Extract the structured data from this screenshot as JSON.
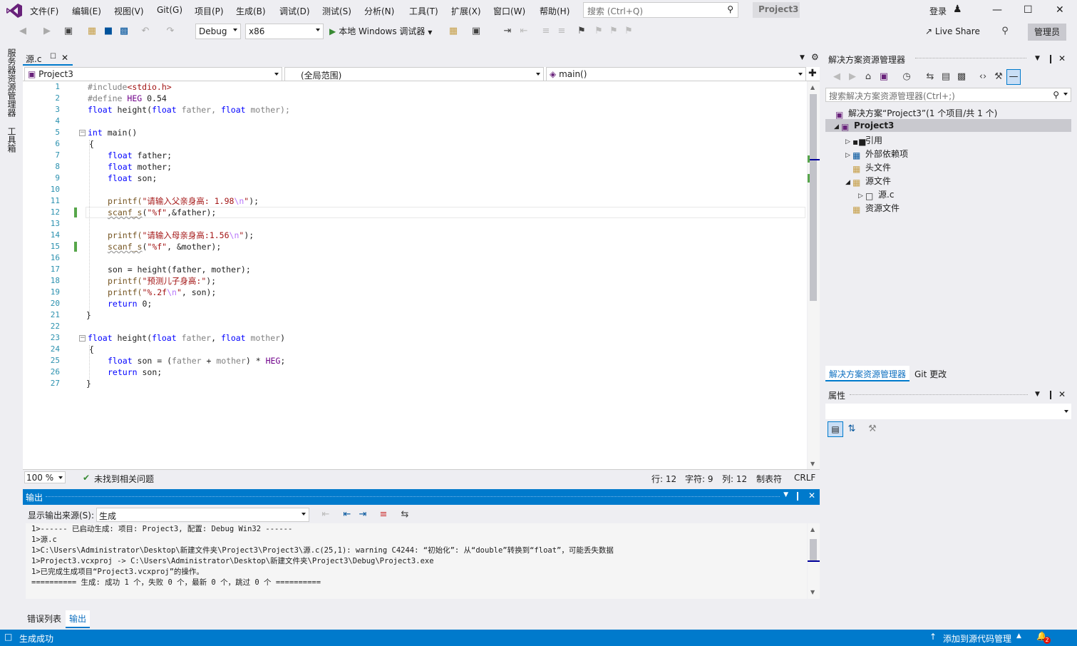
{
  "menubar": {
    "items": [
      "文件(F)",
      "编辑(E)",
      "视图(V)",
      "Git(G)",
      "项目(P)",
      "生成(B)",
      "调试(D)",
      "测试(S)",
      "分析(N)",
      "工具(T)",
      "扩展(X)",
      "窗口(W)",
      "帮助(H)"
    ],
    "search_placeholder": "搜索 (Ctrl+Q)",
    "project_title": "Project3",
    "login": "登录"
  },
  "toolbar": {
    "config": "Debug",
    "platform": "x86",
    "run_label": "本地 Windows 调试器",
    "live_share": "Live Share",
    "admin": "管理员"
  },
  "left_strip": {
    "server_explorer": "服务器资源管理器",
    "toolbox": "工具箱"
  },
  "editor": {
    "tab": "源.c",
    "nav_project": "Project3",
    "nav_scope": "(全局范围)",
    "nav_member": "main()",
    "line_numbers": [
      "1",
      "2",
      "3",
      "4",
      "5",
      "6",
      "7",
      "8",
      "9",
      "10",
      "11",
      "12",
      "13",
      "14",
      "15",
      "16",
      "17",
      "18",
      "19",
      "20",
      "21",
      "22",
      "23",
      "24",
      "25",
      "26",
      "27"
    ],
    "code": {
      "l1a": "#include",
      "l1b": "<stdio.h>",
      "l2a": "#define ",
      "l2b": "HEG",
      "l2c": " 0.54",
      "l3a": "float",
      "l3b": " height(",
      "l3c": "float",
      "l3d": " father, ",
      "l3e": "float",
      "l3f": " mother);",
      "l5a": "int",
      "l5b": " main()",
      "l6": "{",
      "l7a": "float",
      "l7b": " father;",
      "l8a": "float",
      "l8b": " mother;",
      "l9a": "float",
      "l9b": " son;",
      "l11a": "printf(",
      "l11b": "\"请输入父亲身高: 1.98",
      "l11c": "\\n",
      "l11d": "\"",
      "l11e": ");",
      "l12a": "scanf_s",
      "l12b": "(",
      "l12c": "\"%f\"",
      "l12d": ",&father);",
      "l14a": "printf(",
      "l14b": "\"请输入母亲身高:1.56",
      "l14c": "\\n",
      "l14d": "\"",
      "l14e": ");",
      "l15a": "scanf_s",
      "l15b": "(",
      "l15c": "\"%f\"",
      "l15d": ", &mother);",
      "l17a": "son = height(father, mother);",
      "l18a": "printf(",
      "l18b": "\"预测儿子身高:\"",
      "l18c": ");",
      "l19a": "printf(",
      "l19b": "\"%.2f",
      "l19c": "\\n",
      "l19d": "\"",
      "l19e": ", son);",
      "l20a": "return",
      "l20b": " 0;",
      "l21": "}",
      "l23a": "float",
      "l23b": " height(",
      "l23c": "float",
      "l23d": " father",
      "l23e": ", ",
      "l23f": "float",
      "l23g": " mother",
      "l23h": ")",
      "l24": "{",
      "l25a": "float",
      "l25b": " son = (",
      "l25c": "father",
      "l25d": " + ",
      "l25e": "mother",
      "l25f": ") * ",
      "l25g": "HEG",
      "l25h": ";",
      "l26a": "return",
      "l26b": " son;",
      "l27": "}"
    },
    "zoom": "100 %",
    "issues": "未找到相关问题",
    "row": "行: 12",
    "col_char": "字符: 9",
    "col": "列: 12",
    "tabs": "制表符",
    "eol": "CRLF"
  },
  "output": {
    "title": "输出",
    "source_label": "显示输出来源(S):",
    "source_value": "生成",
    "lines": [
      "1>------ 已启动生成: 项目: Project3, 配置: Debug Win32 ------",
      "1>源.c",
      "1>C:\\Users\\Administrator\\Desktop\\新建文件夹\\Project3\\Project3\\源.c(25,1): warning C4244: “初始化”: 从“double”转换到“float”，可能丢失数据",
      "1>Project3.vcxproj -> C:\\Users\\Administrator\\Desktop\\新建文件夹\\Project3\\Debug\\Project3.exe",
      "1>已完成生成项目“Project3.vcxproj”的操作。",
      "========== 生成: 成功 1 个，失败 0 个，最新 0 个，跳过 0 个 =========="
    ],
    "tab_errors": "错误列表",
    "tab_output": "输出"
  },
  "solution": {
    "title": "解决方案资源管理器",
    "search_placeholder": "搜索解决方案资源管理器(Ctrl+;)",
    "solution_label": "解决方案“Project3”(1 个项目/共 1 个)",
    "project": "Project3",
    "references": "引用",
    "external": "外部依赖项",
    "headers": "头文件",
    "sources": "源文件",
    "source_file": "源.c",
    "resources": "资源文件",
    "tab_solution": "解决方案资源管理器",
    "tab_git": "Git 更改"
  },
  "properties": {
    "title": "属性"
  },
  "statusbar": {
    "left": "生成成功",
    "right": "添加到源代码管理",
    "badge": "2"
  },
  "colors": {
    "accent": "#007acc",
    "keyword": "#0000ff",
    "string": "#a31515",
    "line_number": "#2b91af",
    "change_bar": "#57a64a"
  }
}
